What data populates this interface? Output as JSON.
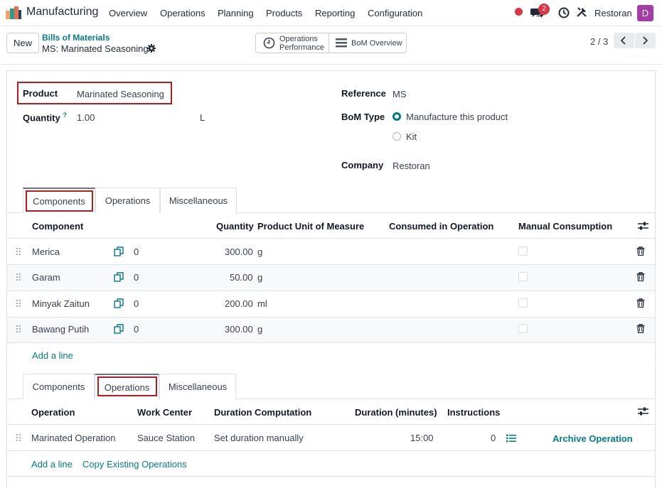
{
  "navbar": {
    "app_name": "Manufacturing",
    "menu": [
      "Overview",
      "Operations",
      "Planning",
      "Products",
      "Reporting",
      "Configuration"
    ],
    "messages_badge": "2",
    "company": "Restoran",
    "avatar_initial": "D",
    "avatar_color": "#a53da8"
  },
  "control_panel": {
    "new_label": "New",
    "breadcrumb_parent": "Bills of Materials",
    "breadcrumb_current": "MS: Marinated Seasoning",
    "op_perf_line1": "Operations",
    "op_perf_line2": "Performance",
    "bom_overview_label": "BoM Overview",
    "pager": "2 / 3"
  },
  "form": {
    "product_label": "Product",
    "product_value": "Marinated Seasoning",
    "quantity_label": "Quantity",
    "quantity_help": "?",
    "quantity_value": "1.00",
    "quantity_uom": "L",
    "reference_label": "Reference",
    "reference_value": "MS",
    "bom_type_label": "BoM Type",
    "bom_type_options": [
      "Manufacture this product",
      "Kit"
    ],
    "bom_type_selected": "Manufacture this product",
    "company_label": "Company",
    "company_value": "Restoran"
  },
  "tabs": [
    "Components",
    "Operations",
    "Miscellaneous"
  ],
  "components_table": {
    "headers": [
      "Component",
      "Quantity",
      "Product Unit of Measure",
      "Consumed in Operation",
      "Manual Consumption"
    ],
    "rows": [
      {
        "component": "Merica",
        "variant_count": "0",
        "quantity": "300.00",
        "uom": "g"
      },
      {
        "component": "Garam",
        "variant_count": "0",
        "quantity": "50.00",
        "uom": "g"
      },
      {
        "component": "Minyak Zaitun",
        "variant_count": "0",
        "quantity": "200.00",
        "uom": "ml"
      },
      {
        "component": "Bawang Putih",
        "variant_count": "0",
        "quantity": "300.00",
        "uom": "g"
      }
    ],
    "add_line": "Add a line"
  },
  "operations_table": {
    "headers": [
      "Operation",
      "Work Center",
      "Duration Computation",
      "Duration (minutes)",
      "Instructions"
    ],
    "rows": [
      {
        "operation": "Marinated Operation",
        "work_center": "Sauce Station",
        "duration_computation": "Set duration manually",
        "duration": "15:00",
        "instructions": "0",
        "action": "Archive Operation"
      }
    ],
    "add_line": "Add a line",
    "copy_existing": "Copy Existing Operations"
  },
  "colors": {
    "accent": "#017e84",
    "highlight_box": "#b91c1c",
    "notification": "#dc3545"
  }
}
